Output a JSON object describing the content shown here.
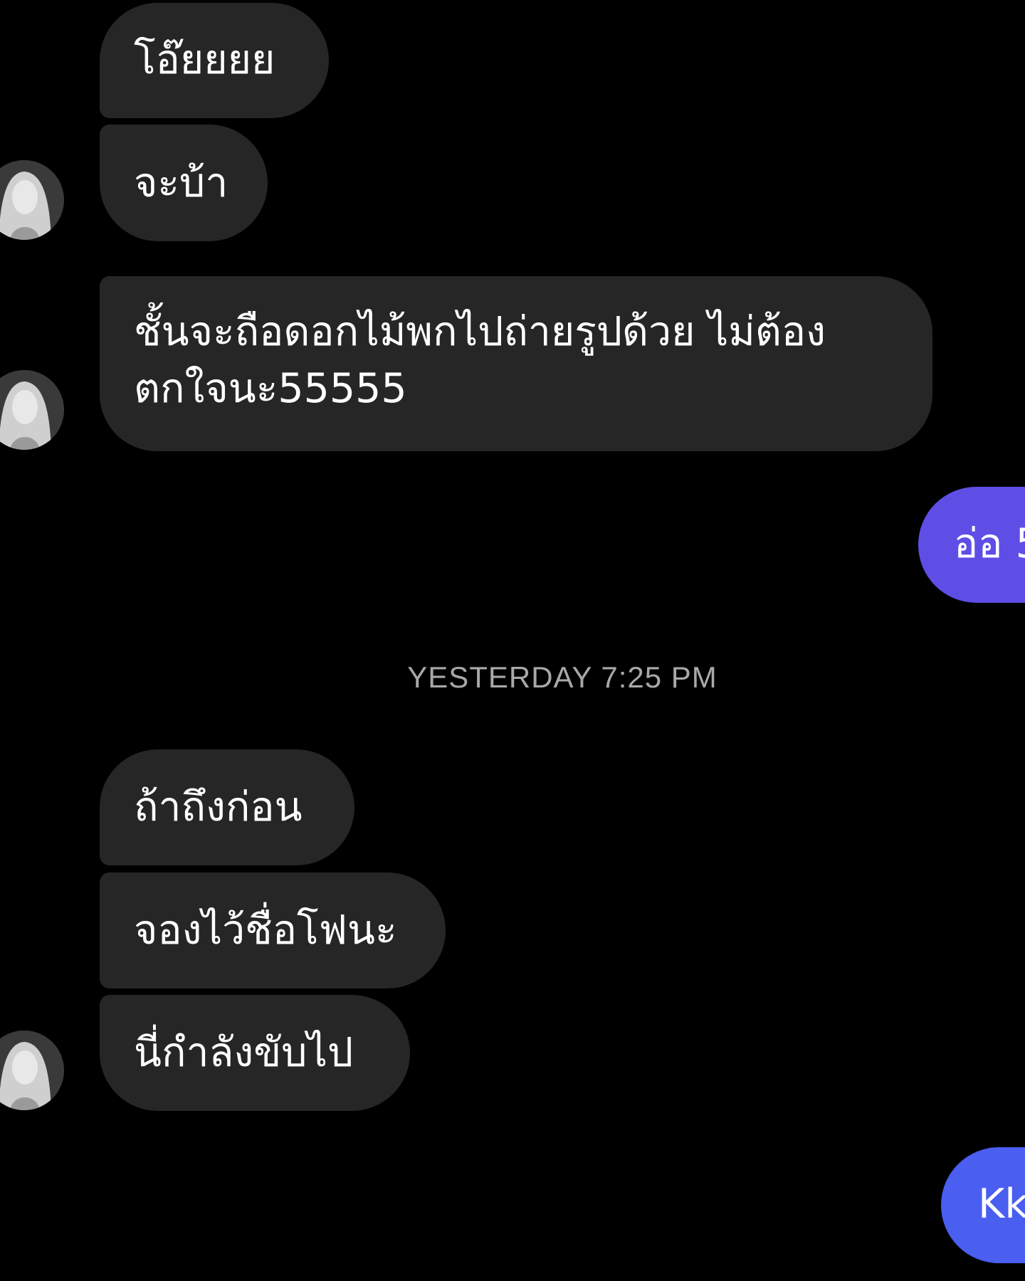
{
  "conversation": {
    "messages_group_1": [
      {
        "text": "โอ๊ยยยย"
      },
      {
        "text": "จะบ้า"
      },
      {
        "text": "ชั้นจะถือดอกไม้พกไปถ่ายรูปด้วย ไม่ต้องตกใจนะ55555"
      }
    ],
    "sent_1": {
      "text": "อ่อ 5"
    },
    "timestamp": "YESTERDAY 7:25 PM",
    "messages_group_2": [
      {
        "text": "ถ้าถึงก่อน"
      },
      {
        "text": "จองไว้ชื่อโฟนะ"
      },
      {
        "text": "นี่กำลังขับไป"
      }
    ],
    "sent_2": {
      "text": "Kk"
    }
  },
  "colors": {
    "background": "#000000",
    "received_bubble": "#262626",
    "sent_bubble_1": "#5f4ee6",
    "sent_bubble_2": "#4a5ef0",
    "timestamp": "#a8a8a8"
  },
  "icons": {
    "avatar": "contact-avatar-photo"
  }
}
